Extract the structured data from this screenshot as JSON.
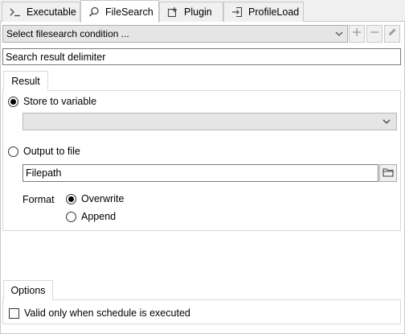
{
  "tabs": [
    {
      "label": "Executable",
      "icon": "terminal-icon"
    },
    {
      "label": "FileSearch",
      "icon": "search-icon"
    },
    {
      "label": "Plugin",
      "icon": "plugin-icon"
    },
    {
      "label": "ProfileLoad",
      "icon": "profile-load-icon"
    }
  ],
  "active_tab": "FileSearch",
  "condition": {
    "selected": "Select filesearch condition ..."
  },
  "toolbar": {
    "add_icon": "plus-icon",
    "remove_icon": "minus-icon",
    "edit_icon": "pencil-icon"
  },
  "delimiter_field": {
    "value": "Search result delimiter"
  },
  "result": {
    "tab_label": "Result",
    "store_variable_label": "Store to variable",
    "store_variable_selected": true,
    "variable_value": "",
    "output_file_label": "Output to file",
    "output_file_selected": false,
    "filepath_value": "Filepath",
    "format_label": "Format",
    "overwrite_label": "Overwrite",
    "overwrite_selected": true,
    "append_label": "Append",
    "append_selected": false
  },
  "options": {
    "tab_label": "Options",
    "valid_only_label": "Valid only when schedule is executed",
    "valid_only_checked": false
  }
}
